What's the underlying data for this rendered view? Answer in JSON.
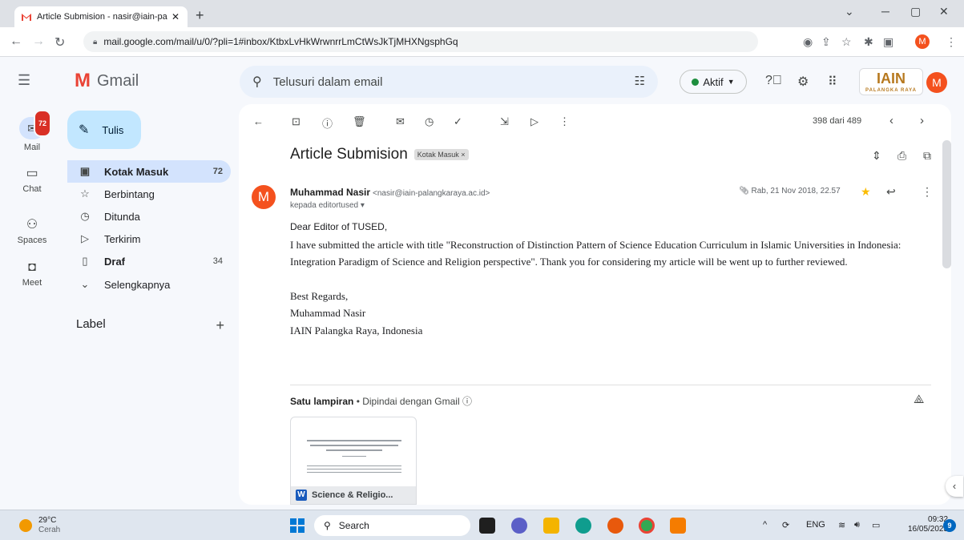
{
  "browser": {
    "tab_title": "Article Submision - nasir@iain-pa",
    "tab_close": "✕",
    "new_tab": "+",
    "url": "mail.google.com/mail/u/0/?pli=1#inbox/KtbxLvHkWrwnrrLmCtWsJkTjMHXNgsphGq",
    "profile_initial": "M"
  },
  "header": {
    "app_name": "Gmail",
    "search_placeholder": "Telusuri dalam email",
    "status_label": "Aktif",
    "org_logo_text": "IAIN",
    "org_logo_sub": "PALANGKA RAYA",
    "avatar_initial": "M"
  },
  "rail": {
    "mail_label": "Mail",
    "mail_badge": "72",
    "chat_label": "Chat",
    "spaces_label": "Spaces",
    "meet_label": "Meet"
  },
  "sidebar": {
    "compose_label": "Tulis",
    "items": [
      {
        "label": "Kotak Masuk",
        "count": "72",
        "icon": "inbox-icon"
      },
      {
        "label": "Berbintang",
        "count": "",
        "icon": "star-icon"
      },
      {
        "label": "Ditunda",
        "count": "",
        "icon": "clock-icon"
      },
      {
        "label": "Terkirim",
        "count": "",
        "icon": "send-icon"
      },
      {
        "label": "Draf",
        "count": "34",
        "icon": "draft-icon"
      },
      {
        "label": "Selengkapnya",
        "count": "",
        "icon": "chevron-down-icon"
      }
    ],
    "labels_header": "Label",
    "labels_add": "+"
  },
  "message": {
    "pager": "398 dari 489",
    "subject": "Article Submision",
    "subject_chip": "Kotak Masuk ×",
    "sender_initial": "M",
    "sender_name": "Muhammad Nasir",
    "sender_email": "<nasir@iain-palangkaraya.ac.id>",
    "to_line": "kepada editortused ▾",
    "date": "Rab, 21 Nov 2018, 22.57",
    "greeting": "Dear Editor of TUSED,",
    "body_para": "I have submitted the article with title \"Reconstruction of Distinction Pattern of Science Education Curriculum in Islamic Universities in Indonesia:  Integration Paradigm of Science and Religion perspective\". Thank you for considering my article will be went up to further reviewed.",
    "sign_1": "Best Regards,",
    "sign_2": "Muhammad Nasir",
    "sign_3": "IAIN Palangka Raya, Indonesia",
    "attach_count": "Satu lampiran",
    "attach_scan": " • Dipindai dengan Gmail ⓘ",
    "attach_name": "Science & Religio..."
  },
  "taskbar": {
    "temp": "29°C",
    "condition": "Cerah",
    "search_label": "Search",
    "lang": "ENG",
    "time": "09:32",
    "date": "16/05/2023",
    "notif_count": "9"
  },
  "colors": {
    "accent": "#0b57d0",
    "selected_nav": "#d3e3fd",
    "compose": "#c2e7ff",
    "avatar": "#f4511e",
    "star": "#fbbc04"
  }
}
